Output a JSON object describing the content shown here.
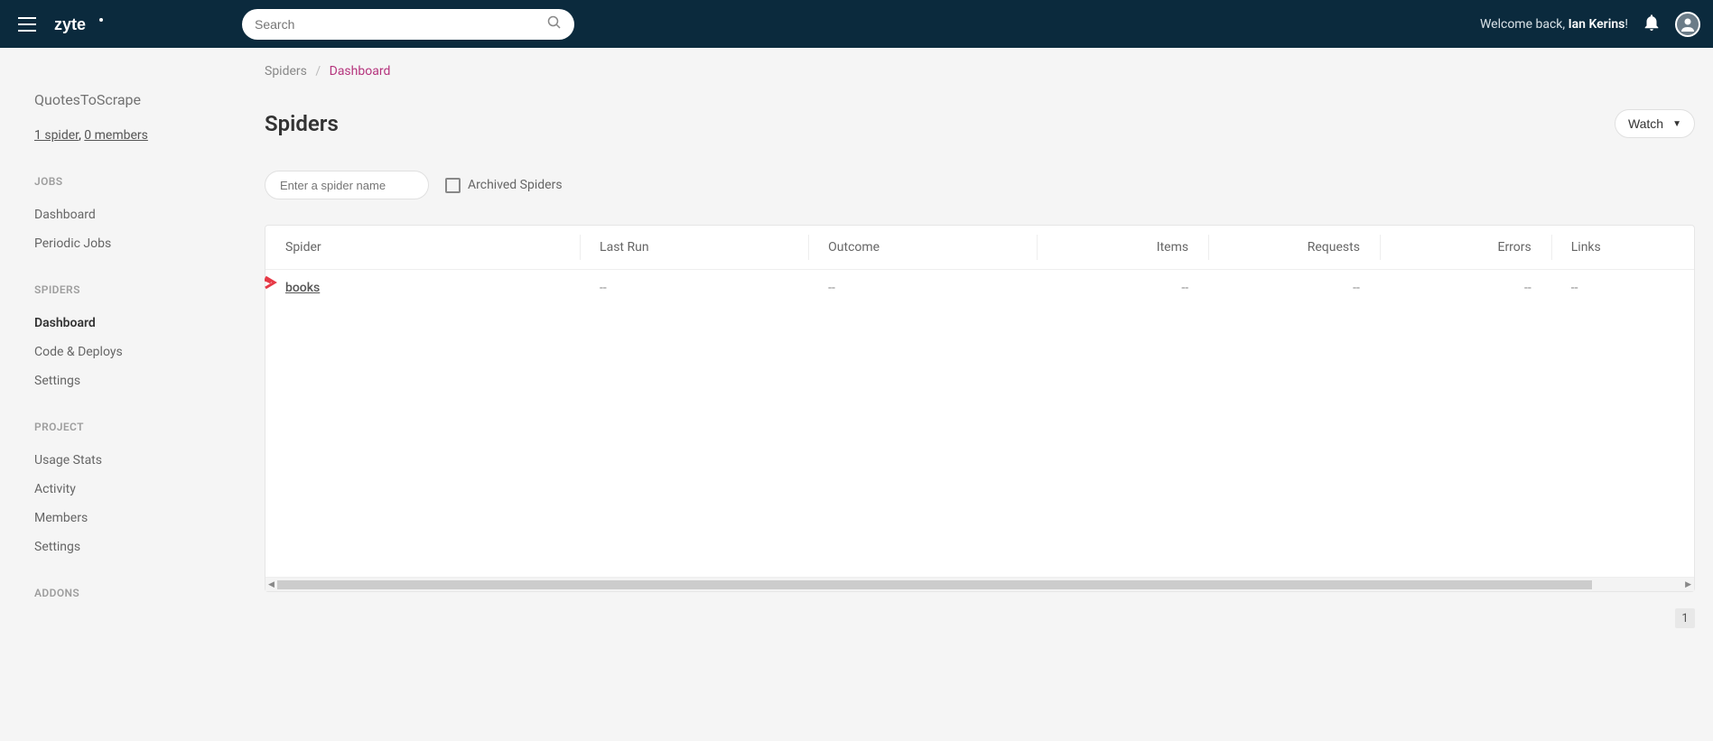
{
  "header": {
    "search_placeholder": "Search",
    "welcome_prefix": "Welcome back, ",
    "welcome_name": "Ian Kerins",
    "welcome_suffix": "!"
  },
  "sidebar": {
    "project_name": "QuotesToScrape",
    "spider_count": "1 spider",
    "meta_sep": ", ",
    "member_count": "0 members",
    "sections": {
      "jobs_label": "JOBS",
      "spiders_label": "SPIDERS",
      "project_label": "PROJECT",
      "addons_label": "ADDONS"
    },
    "jobs": [
      {
        "label": "Dashboard"
      },
      {
        "label": "Periodic Jobs"
      }
    ],
    "spiders": [
      {
        "label": "Dashboard"
      },
      {
        "label": "Code & Deploys"
      },
      {
        "label": "Settings"
      }
    ],
    "project": [
      {
        "label": "Usage Stats"
      },
      {
        "label": "Activity"
      },
      {
        "label": "Members"
      },
      {
        "label": "Settings"
      }
    ]
  },
  "breadcrumb": {
    "spiders": "Spiders",
    "sep": "/",
    "dashboard": "Dashboard"
  },
  "page": {
    "title": "Spiders",
    "watch_label": "Watch",
    "filter_placeholder": "Enter a spider name",
    "archived_label": "Archived Spiders"
  },
  "table": {
    "columns": {
      "spider": "Spider",
      "last_run": "Last Run",
      "outcome": "Outcome",
      "items": "Items",
      "requests": "Requests",
      "errors": "Errors",
      "links": "Links"
    },
    "rows": [
      {
        "spider": "books",
        "last_run": "--",
        "outcome": "--",
        "items": "--",
        "requests": "--",
        "errors": "--",
        "links": "--"
      }
    ]
  },
  "pagination": {
    "current": "1"
  }
}
